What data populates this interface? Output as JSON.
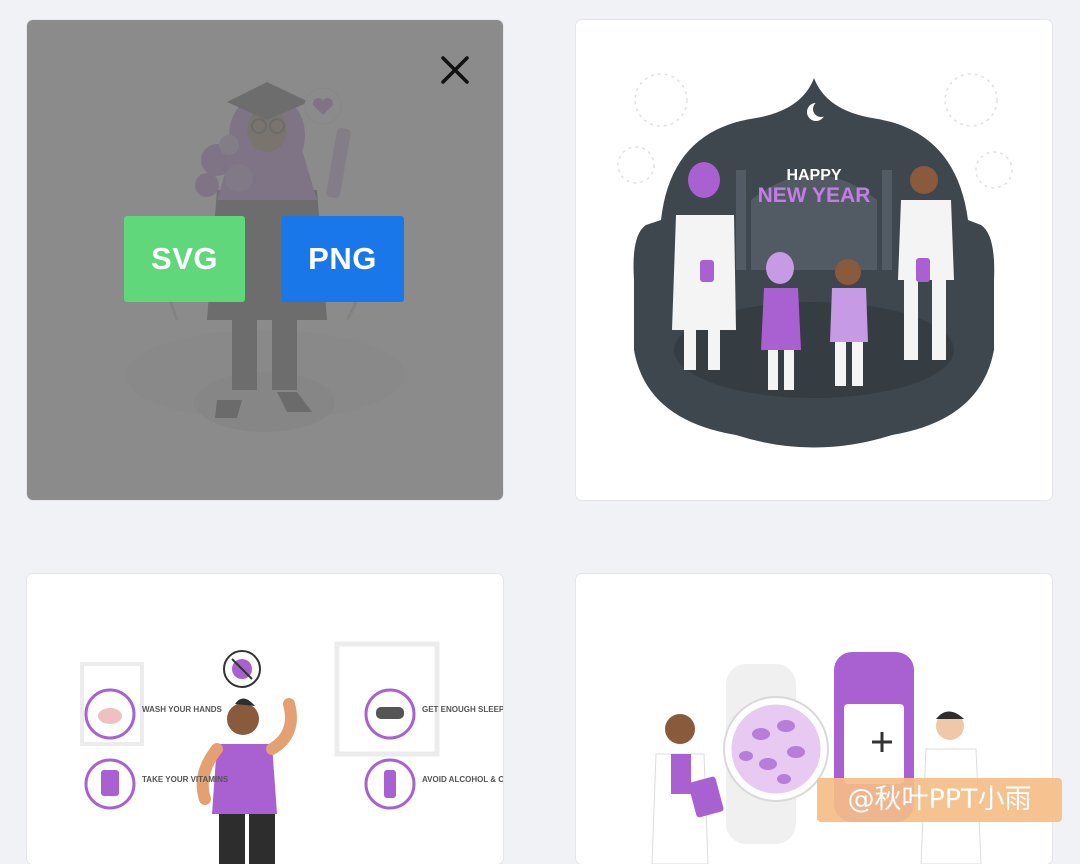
{
  "overlay": {
    "svg_label": "SVG",
    "png_label": "PNG"
  },
  "card2": {
    "greeting_line1": "HAPPY",
    "greeting_line2": "NEW YEAR"
  },
  "card3": {
    "tips": [
      "WASH YOUR HANDS",
      "TAKE YOUR VITAMINS",
      "GET ENOUGH SLEEP",
      "AVOID ALCOHOL & CIGARETTES"
    ]
  },
  "watermark": {
    "text": "@秋叶PPT小雨"
  },
  "colors": {
    "accent": "#a960d1",
    "svg_button": "#5fd77a",
    "png_button": "#1a77ea",
    "dark_scene": "#3f474e"
  },
  "icons": [
    "close-icon"
  ]
}
